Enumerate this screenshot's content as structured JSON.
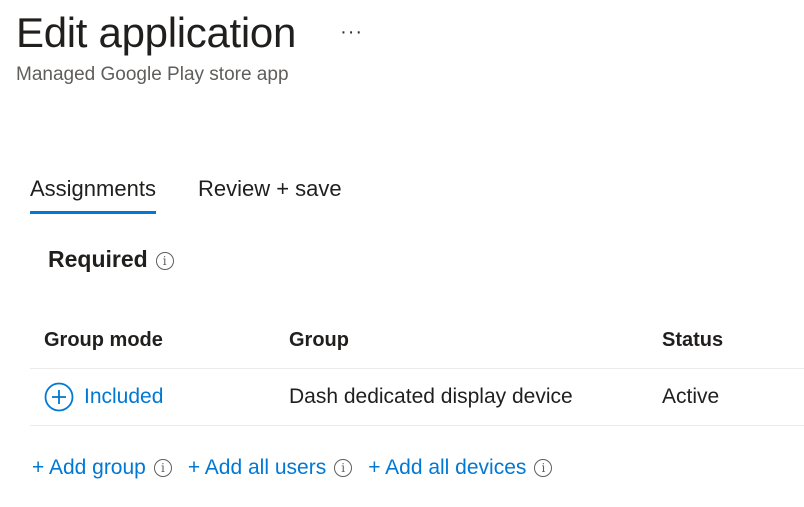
{
  "header": {
    "title": "Edit application",
    "more_label": "···",
    "subtitle": "Managed Google Play store app"
  },
  "tabs": [
    {
      "label": "Assignments",
      "active": true
    },
    {
      "label": "Review + save",
      "active": false
    }
  ],
  "section": {
    "title": "Required",
    "info_icon": "i"
  },
  "table": {
    "columns": [
      "Group mode",
      "Group",
      "Status"
    ],
    "rows": [
      {
        "mode": "Included",
        "mode_icon": "plus-circle-icon",
        "group": "Dash dedicated display device",
        "status": "Active"
      }
    ]
  },
  "actions": {
    "add_group": "+ Add group",
    "add_all_users": "+ Add all users",
    "add_all_devices": "+ Add all devices",
    "info_icon": "i"
  },
  "colors": {
    "accent": "#0078d4",
    "text": "#201f1e",
    "muted": "#605e5c",
    "divider": "#edebe9"
  }
}
